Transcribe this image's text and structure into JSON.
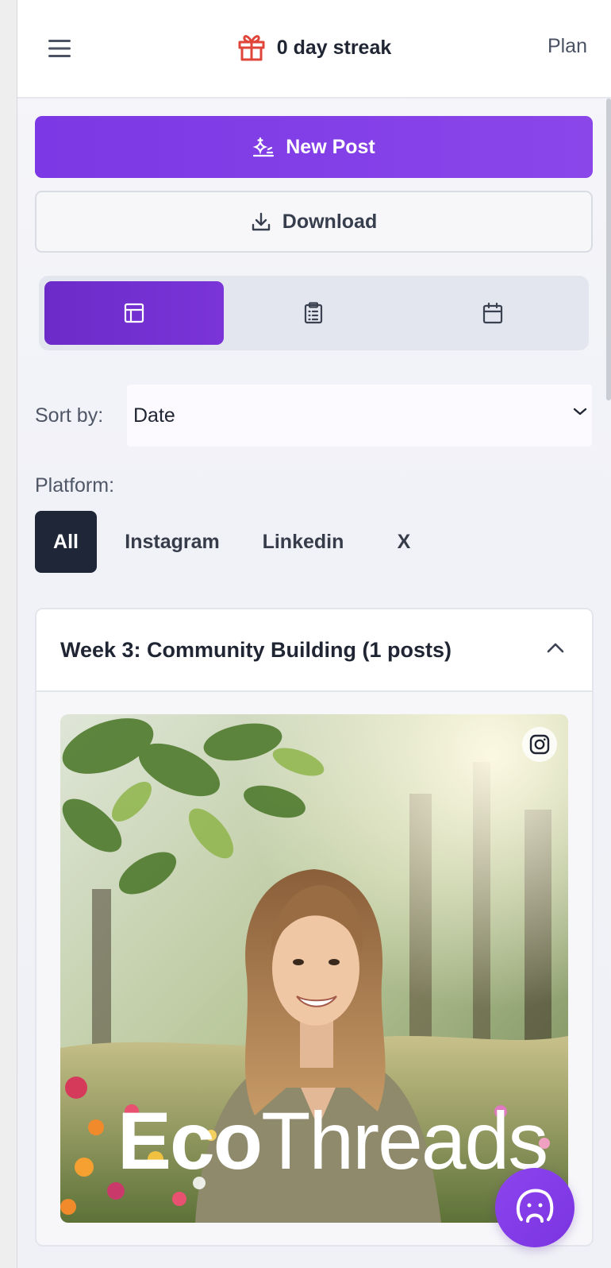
{
  "header": {
    "streak_text": "0 day streak",
    "plan_label": "Plan",
    "menu_icon": "hamburger-menu-icon",
    "streak_icon": "gift-icon"
  },
  "actions": {
    "new_post_label": "New Post",
    "new_post_icon": "sparkle-icon",
    "download_label": "Download",
    "download_icon": "download-icon"
  },
  "view_toggle": {
    "options": [
      {
        "icon": "table-view-icon",
        "active": true
      },
      {
        "icon": "clipboard-list-icon",
        "active": false
      },
      {
        "icon": "calendar-icon",
        "active": false
      }
    ]
  },
  "sort": {
    "label": "Sort by:",
    "selected": "Date"
  },
  "platform_filter": {
    "label": "Platform:",
    "chips": [
      "All",
      "Instagram",
      "Linkedin",
      "X"
    ],
    "selected": "All"
  },
  "week_section": {
    "title": "Week 3: Community Building (1 posts)",
    "expanded": true
  },
  "post": {
    "platform_icon": "instagram-icon",
    "brand_bold": "Eco",
    "brand_light": "Threads"
  },
  "colors": {
    "primary": "#7c3aed",
    "toggle_active": "#6d2ec4",
    "chip_active": "#1f2638",
    "streak_icon": "#e0453a"
  }
}
